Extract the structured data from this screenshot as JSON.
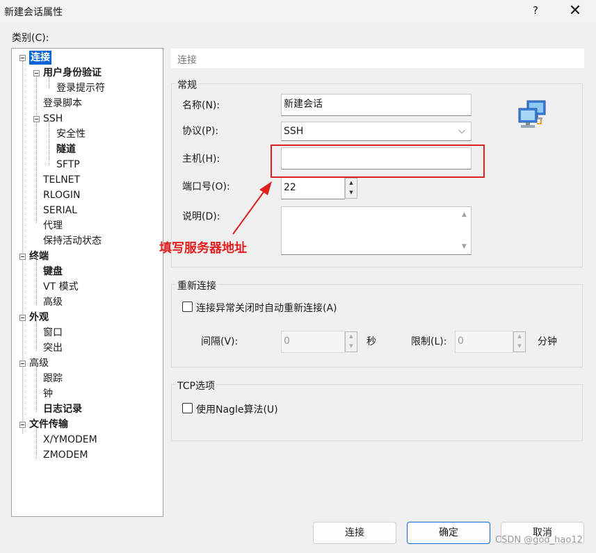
{
  "window": {
    "title": "新建会话属性",
    "help_label": "?",
    "close_label": "✕"
  },
  "category": {
    "label": "类别(C):",
    "tree": [
      {
        "label": "连接",
        "bold": true,
        "selected": true
      },
      {
        "label": "用户身份验证",
        "bold": true
      },
      {
        "label": "登录提示符",
        "bold": false
      },
      {
        "label": "登录脚本",
        "bold": false
      },
      {
        "label": "SSH",
        "bold": false
      },
      {
        "label": "安全性",
        "bold": false
      },
      {
        "label": "隧道",
        "bold": true
      },
      {
        "label": "SFTP",
        "bold": false
      },
      {
        "label": "TELNET",
        "bold": false
      },
      {
        "label": "RLOGIN",
        "bold": false
      },
      {
        "label": "SERIAL",
        "bold": false
      },
      {
        "label": "代理",
        "bold": false
      },
      {
        "label": "保持活动状态",
        "bold": false
      },
      {
        "label": "终端",
        "bold": true
      },
      {
        "label": "键盘",
        "bold": true
      },
      {
        "label": "VT 模式",
        "bold": false
      },
      {
        "label": "高级",
        "bold": false
      },
      {
        "label": "外观",
        "bold": true
      },
      {
        "label": "窗口",
        "bold": false
      },
      {
        "label": "突出",
        "bold": false
      },
      {
        "label": "高级",
        "bold": false
      },
      {
        "label": "跟踪",
        "bold": false
      },
      {
        "label": "钟",
        "bold": false
      },
      {
        "label": "日志记录",
        "bold": true
      },
      {
        "label": "文件传输",
        "bold": true
      },
      {
        "label": "X/YMODEM",
        "bold": false
      },
      {
        "label": "ZMODEM",
        "bold": false
      }
    ]
  },
  "section_title": "连接",
  "general": {
    "title": "常规",
    "name_label": "名称(N):",
    "name_value": "新建会话",
    "protocol_label": "协议(P):",
    "protocol_value": "SSH",
    "host_label": "主机(H):",
    "host_value": "",
    "port_label": "端口号(O):",
    "port_value": "22",
    "desc_label": "说明(D):",
    "desc_value": ""
  },
  "reconnect": {
    "title": "重新连接",
    "checkbox_label": "连接异常关闭时自动重新连接(A)",
    "checked": false,
    "interval_label": "间隔(V):",
    "interval_value": "0",
    "interval_unit": "秒",
    "limit_label": "限制(L):",
    "limit_value": "0",
    "limit_unit": "分钟"
  },
  "tcp": {
    "title": "TCP选项",
    "nagle_label": "使用Nagle算法(U)",
    "checked": false
  },
  "annotation": {
    "text": "填写服务器地址",
    "color": "#e02020"
  },
  "buttons": {
    "connect": "连接",
    "ok": "确定",
    "cancel": "取消"
  },
  "watermark": "CSDN @god_hao12",
  "colors": {
    "selection": "#0a64d8",
    "annotation": "#e02020",
    "primary_border": "#0a64d8"
  }
}
